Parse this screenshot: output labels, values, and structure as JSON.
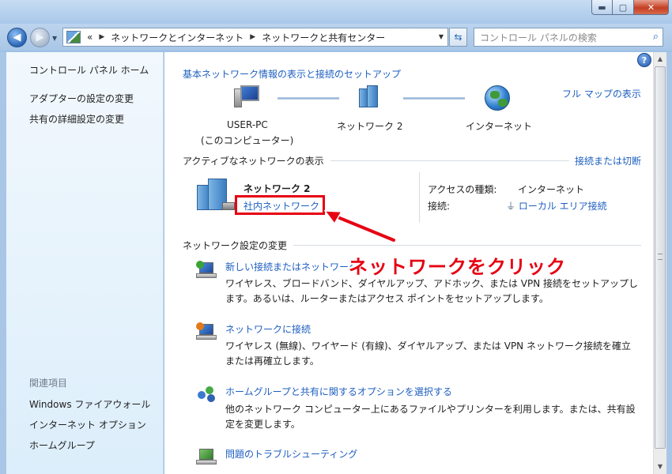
{
  "window": {
    "controls": {
      "minimize": "▬",
      "maximize": "▢",
      "close": "✕"
    }
  },
  "address": {
    "crumb_prefix": "«",
    "crumbs": [
      "ネットワークとインターネット",
      "ネットワークと共有センター"
    ],
    "search_placeholder": "コントロール パネルの検索"
  },
  "sidebar": {
    "home": "コントロール パネル ホーム",
    "adapter": "アダプターの設定の変更",
    "sharing": "共有の詳細設定の変更",
    "related_header": "関連項目",
    "related": [
      "Windows ファイアウォール",
      "インターネット オプション",
      "ホームグループ"
    ]
  },
  "main": {
    "help": "?",
    "heading": "基本ネットワーク情報の表示と接続のセットアップ",
    "full_map": "フル マップの表示",
    "map": {
      "pc_name": "USER-PC",
      "pc_sub": "(このコンピューター)",
      "network": "ネットワーク 2",
      "internet": "インターネット"
    },
    "active_heading": "アクティブなネットワークの表示",
    "connect_disconnect": "接続または切断",
    "active": {
      "name": "ネットワーク 2",
      "type_link": "社内ネットワーク",
      "access_label": "アクセスの種類:",
      "access_value": "インターネット",
      "conn_label": "接続:",
      "conn_value": "ローカル エリア接続"
    },
    "change_heading": "ネットワーク設定の変更",
    "tasks": [
      {
        "title": "新しい接続またはネットワーク",
        "desc1": "ワイヤレス、ブロードバンド、ダイヤルアップ、アドホック、または VPN 接続をセットアップし",
        "desc2": "ます。あるいは、ルーターまたはアクセス ポイントをセットアップします。"
      },
      {
        "title": "ネットワークに接続",
        "desc1": "ワイヤレス (無線)、ワイヤード (有線)、ダイヤルアップ、または VPN ネットワーク接続を確立",
        "desc2": "または再確立します。"
      },
      {
        "title": "ホームグループと共有に関するオプションを選択する",
        "desc1": "他のネットワーク コンピューター上にあるファイルやプリンターを利用します。または、共有設",
        "desc2": "定を変更します。"
      },
      {
        "title": "問題のトラブルシューティング",
        "desc1": "",
        "desc2": ""
      }
    ]
  },
  "annotation": {
    "callout": "ネットワークをクリック",
    "color": "#e60012"
  },
  "colors": {
    "link": "#1e5fc0",
    "sidebar_bg": "#dceefb",
    "frame": "#a9c6e7"
  }
}
